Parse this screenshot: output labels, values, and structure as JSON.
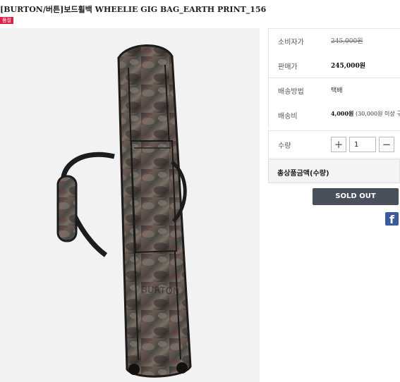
{
  "product": {
    "title": "[BURTON/버튼]보드휠백 WHEELIE GIG BAG_EARTH PRINT_156",
    "badge": "품절",
    "image_name": "earth print wheelie gig bag"
  },
  "info": {
    "consumer_price_label": "소비자가",
    "consumer_price": "245,000원",
    "sale_price_label": "판매가",
    "sale_price": "245,000원",
    "shipping_method_label": "배송방법",
    "shipping_method": "택배",
    "shipping_fee_label": "배송비",
    "shipping_fee": "4,000원",
    "shipping_fee_note": "(30,000원 이상 구"
  },
  "quantity": {
    "label": "수량",
    "value": "1",
    "plus": "+",
    "minus": "−"
  },
  "total": {
    "label": "총상품금액(수량)"
  },
  "actions": {
    "soldout_label": "SOLD OUT",
    "facebook_label": "f"
  },
  "colors": {
    "badge": "#e0204a",
    "soldout_button": "#4a4f5c",
    "facebook": "#3b5a9a"
  }
}
